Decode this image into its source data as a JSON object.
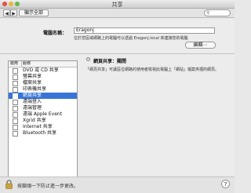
{
  "window": {
    "title": "共享"
  },
  "toolbar": {
    "back_label": "◀",
    "forward_label": "▶",
    "show_all_label": "顯示全部",
    "search_placeholder": ""
  },
  "computer_name": {
    "label": "電腦名稱：",
    "value": "Eragonj",
    "help": "位於您區域網路上的電腦可以透過 Eragonj.local 來連接您的電腦",
    "edit_label": "編輯⋯"
  },
  "services": {
    "header_on": "啟用",
    "header_service": "服務",
    "items": [
      {
        "label": "DVD 或 CD 共享",
        "checked": false
      },
      {
        "label": "螢幕共享",
        "checked": false
      },
      {
        "label": "檔案共享",
        "checked": false
      },
      {
        "label": "印表機共享",
        "checked": false
      },
      {
        "label": "網頁共享",
        "checked": false,
        "selected": true
      },
      {
        "label": "遠端登入",
        "checked": false
      },
      {
        "label": "遠端管理",
        "checked": false
      },
      {
        "label": "遠端 Apple Event",
        "checked": false
      },
      {
        "label": "Xgrid 共享",
        "checked": false
      },
      {
        "label": "Internet 共享",
        "checked": false
      },
      {
        "label": "Bluetooth 共享",
        "checked": false
      }
    ]
  },
  "detail": {
    "status": "網頁共享：關閉",
    "description": "「網頁共享」可讓區位網路的使用者檢視此電腦上「網站」檔案夾裡的網頁。"
  },
  "footer": {
    "lock_text": "按鎖頭一下防止進一步更改。",
    "help_label": "?"
  }
}
